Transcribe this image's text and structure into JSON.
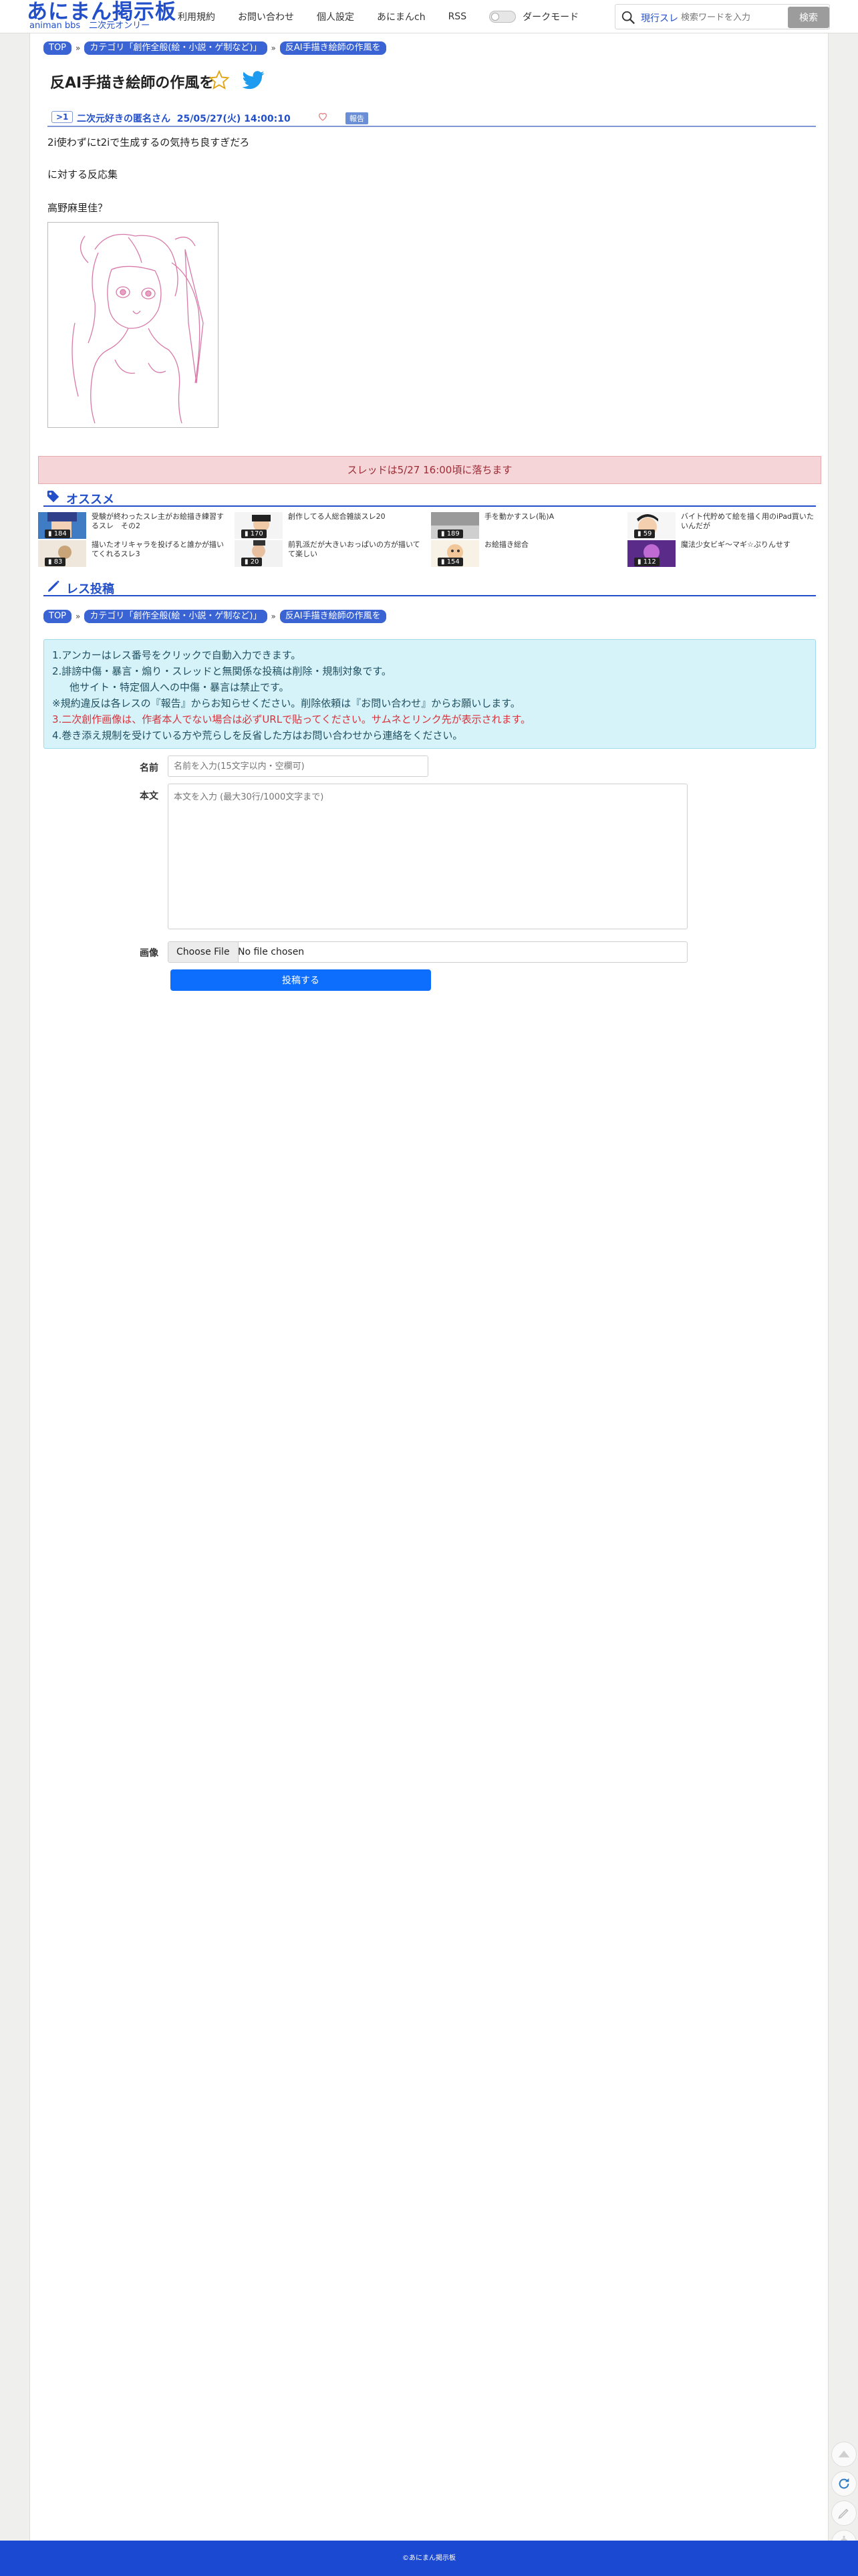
{
  "header": {
    "logo_main": "あにまん掲示板",
    "logo_sub": "animan bbs　二次元オンリー",
    "nav": [
      "利用規約",
      "お問い合わせ",
      "個人設定",
      "あにまんch",
      "RSS"
    ],
    "dark_mode_label": "ダークモード",
    "search_scope": "現行スレ",
    "search_placeholder": "検索ワードを入力",
    "search_button": "検索"
  },
  "breadcrumb": [
    "TOP",
    "カテゴリ「創作全般(絵・小説・ゲ制など)」",
    "反AI手描き絵師の作風を"
  ],
  "thread": {
    "title": "反AI手描き絵師の作風を",
    "post": {
      "number": ">1",
      "author": "二次元好きの匿名さん",
      "date": "25/05/27(火) 14:00:10",
      "report_label": "報告",
      "lines": [
        "2i使わずにt2iで生成するの気持ち良すぎだろ",
        "に対する反応集",
        "高野麻里佳？"
      ]
    }
  },
  "fall_notice": "スレッドは5/27 16:00頃に落ちます",
  "recommend": {
    "heading": "オススメ",
    "items": [
      {
        "title": "受験が終わったスレ主がお絵描き練習するスレ　その2",
        "count": "184"
      },
      {
        "title": "創作してる人総合雑談スレ20",
        "count": "170"
      },
      {
        "title": "手を動かすスレ(恥)A",
        "count": "189"
      },
      {
        "title": "バイト代貯めて絵を描く用のiPad買いたいんだが",
        "count": "59"
      },
      {
        "title": "描いたオリキャラを投げると誰かが描いてくれるスレ3",
        "count": "83"
      },
      {
        "title": "前乳派だが大きいおっぱいの方が描いてて楽しい",
        "count": "20"
      },
      {
        "title": "お絵描き総合",
        "count": "154"
      },
      {
        "title": "魔法少女ビギ～マギ☆ぷりんせす",
        "count": "112"
      }
    ]
  },
  "post_form": {
    "heading": "レス投稿",
    "rules": [
      "1.アンカーはレス番号をクリックで自動入力できます。",
      "2.誹謗中傷・暴言・煽り・スレッドと無関係な投稿は削除・規制対象です。",
      "他サイト・特定個人への中傷・暴言は禁止です。",
      "※規約違反は各レスの『報告』からお知らせください。削除依頼は『お問い合わせ』からお願いします。",
      "3.二次創作画像は、作者本人でない場合は必ずURLで貼ってください。サムネとリンク先が表示されます。",
      "4.巻き添え規制を受けている方や荒らしを反省した方はお問い合わせから連絡をください。"
    ],
    "name_label": "名前",
    "name_placeholder": "名前を入力(15文字以内・空欄可)",
    "body_label": "本文",
    "body_placeholder": "本文を入力 (最大30行/1000文字まで)",
    "image_label": "画像",
    "file_button": "Choose File",
    "file_status": "No file chosen",
    "submit_label": "投稿する"
  },
  "footer": "©あにまん掲示板",
  "colors": {
    "brand": "#2350c8",
    "footer": "#1c49d1",
    "notice_bg": "#f6d5d8",
    "rules_bg": "#d6f3f9",
    "submit": "#0d6efd"
  }
}
